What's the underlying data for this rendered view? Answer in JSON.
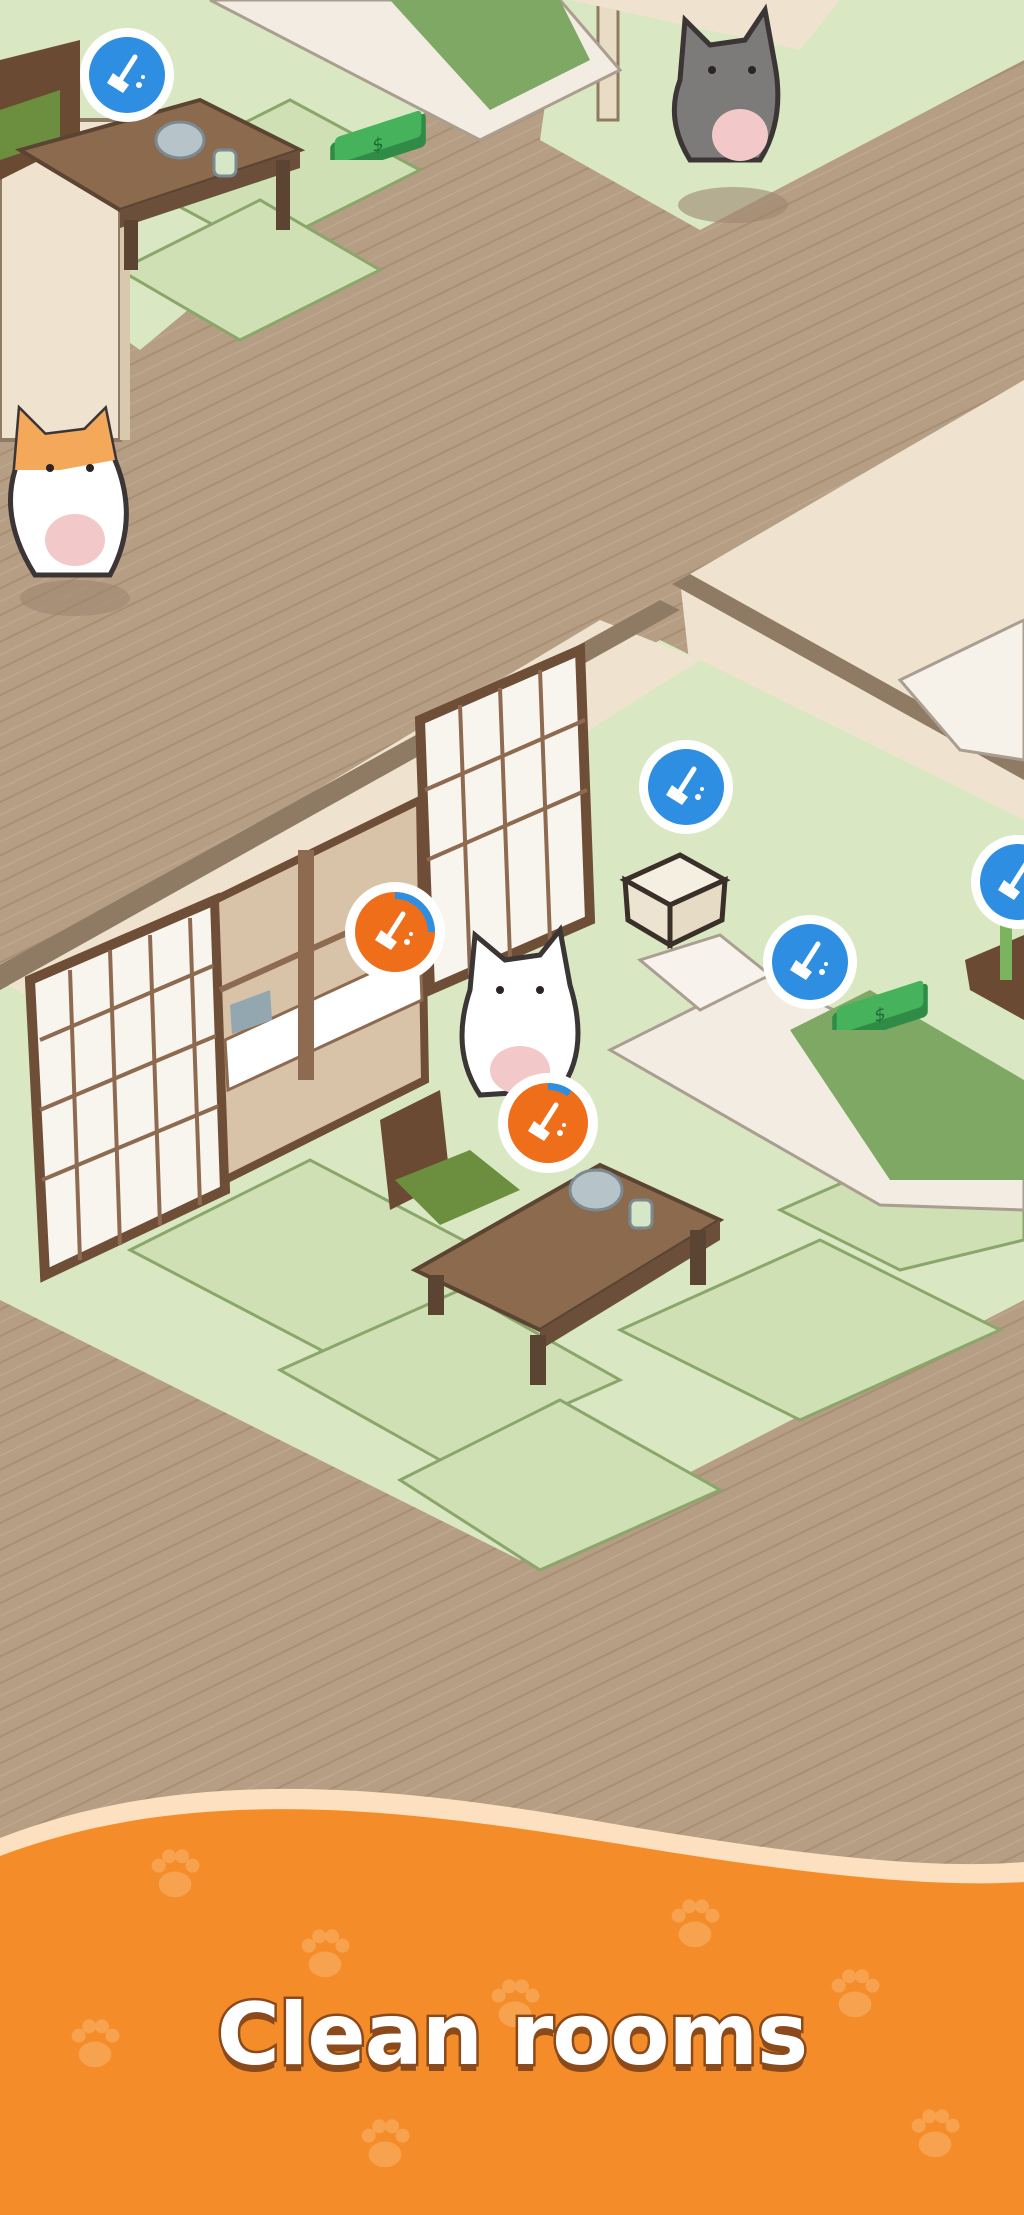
{
  "caption": {
    "text": "Clean rooms"
  },
  "colors": {
    "caption_band": "#f58c2a",
    "caption_band_edge": "#fde0c0",
    "caption_outline": "#8a4a1c",
    "clean_icon_blue": "#2e8ee2",
    "clean_icon_orange": "#ee6e1a",
    "wood_floor": "#b69e84",
    "tatami": "#d9e8c2",
    "wall": "#efe3cf"
  },
  "icons": {
    "task_icon": "broom-icon",
    "money_icon": "cash-bundle-icon",
    "paw_pattern": "paw-print-icon"
  },
  "cleaning_tasks": [
    {
      "name": "room-top-left",
      "state": "pending"
    },
    {
      "name": "room-middle-lantern",
      "state": "pending"
    },
    {
      "name": "room-middle-futon",
      "state": "pending"
    },
    {
      "name": "room-right-edge",
      "state": "pending"
    },
    {
      "name": "room-middle-shelf",
      "state": "in-progress",
      "progress": 0.25
    },
    {
      "name": "room-middle-table",
      "state": "in-progress",
      "progress": 0.1
    }
  ],
  "cats": [
    {
      "name": "gray-tabby-cat"
    },
    {
      "name": "orange-white-cat"
    },
    {
      "name": "white-cat"
    }
  ]
}
